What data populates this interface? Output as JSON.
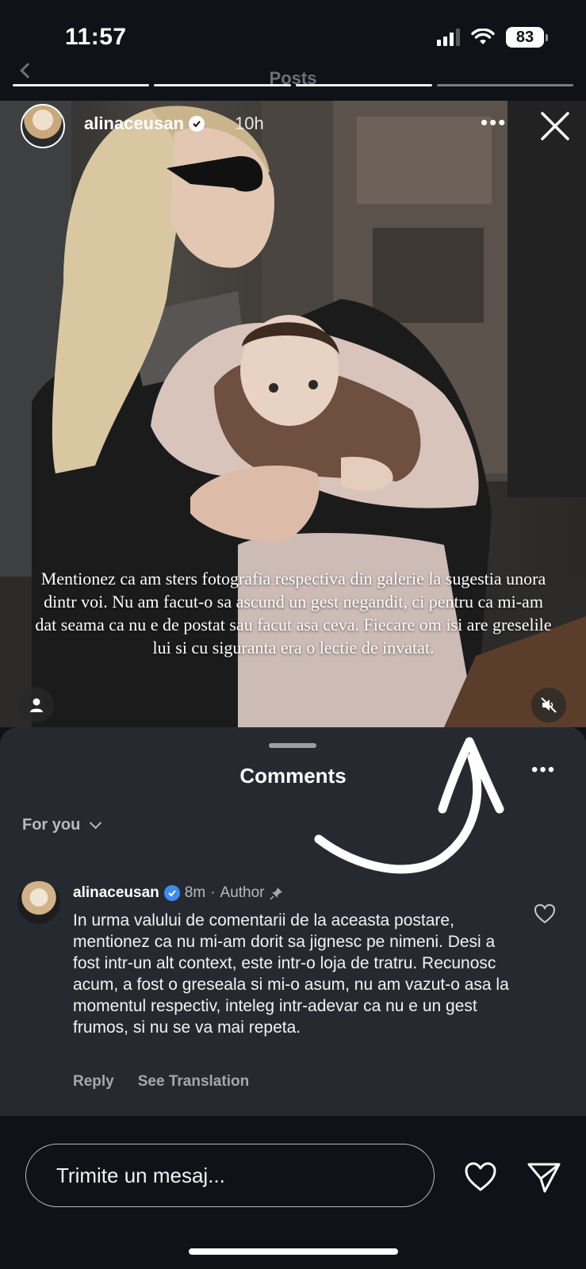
{
  "status_bar": {
    "time": "11:57",
    "battery": "83"
  },
  "top_nav": {
    "title": "Posts"
  },
  "story": {
    "username": "alinaceusan",
    "time_ago": "10h",
    "more": "•••",
    "caption": "Mentionez ca am sters fotografia respectiva din galerie la sugestia unora dintr voi. Nu am facut-o sa ascund un gest negandit, ci pentru ca mi-am dat seama ca nu e de postat sau facut asa ceva. Fiecare om isi are greselile lui si cu siguranta era o lectie de invatat.",
    "progress_segments": 4,
    "progress_done": 3
  },
  "comments_sheet": {
    "title": "Comments",
    "more": "•••",
    "filter_label": "For you",
    "comments": [
      {
        "username": "alinaceusan",
        "time": "8m",
        "separator": "·",
        "role": "Author",
        "text": "In urma valului de comentarii de la aceasta postare, mentionez ca nu mi-am dorit sa jignesc pe nimeni. Desi a fost intr-un alt context, este intr-o loja de tratru. Recunosc acum, a fost o greseala si mi-o asum, nu am vazut-o asa la momentul respectiv, inteleg intr-adevar ca nu e un gest frumos, si nu se va mai repeta.",
        "reply_label": "Reply",
        "translate_label": "See Translation"
      }
    ]
  },
  "message_bar": {
    "placeholder": "Trimite un mesaj..."
  },
  "icons": {
    "close": "close-icon",
    "more": "more-icon",
    "tag": "person-tag-icon",
    "mute": "speaker-muted-icon",
    "heart": "heart-icon",
    "send": "send-icon",
    "pin": "pin-icon",
    "verified": "verified-badge-icon"
  }
}
